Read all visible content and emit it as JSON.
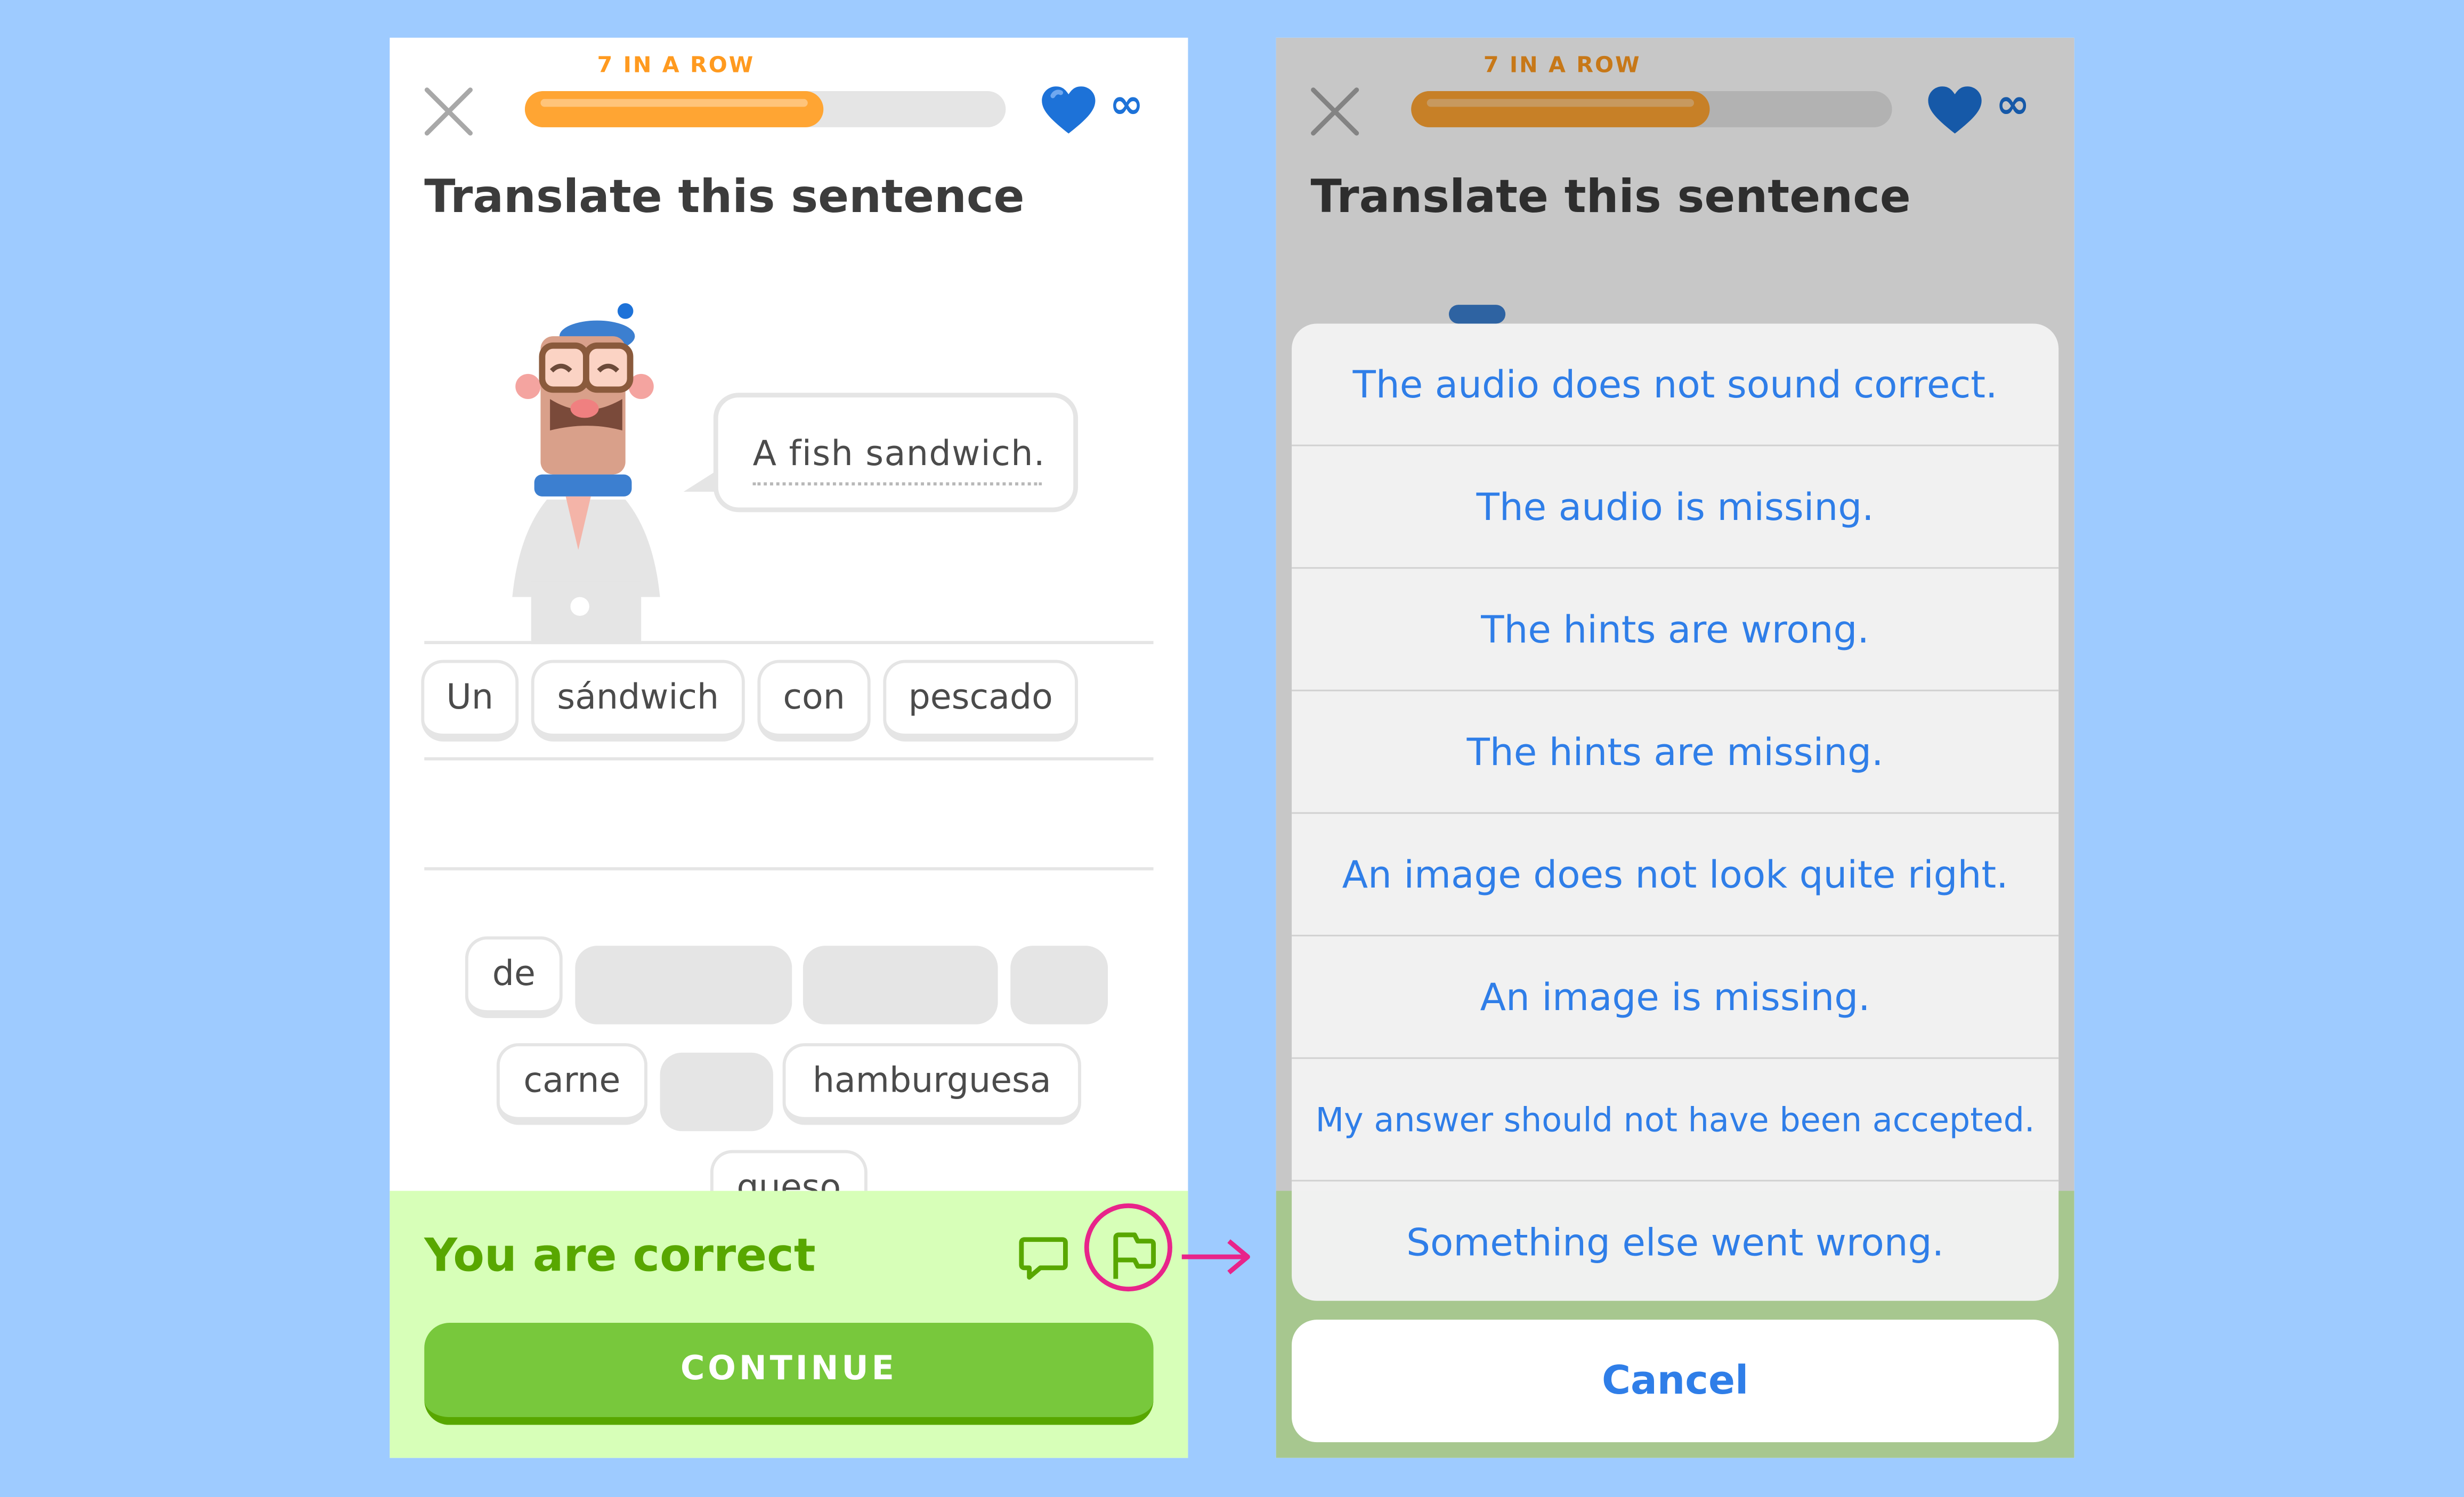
{
  "screen_left": {
    "streak_label": "7 IN A ROW",
    "progress": 0.62,
    "lives": "∞",
    "title": "Translate this sentence",
    "prompt": "A fish sandwich.",
    "answer_tiles": [
      "Un",
      "sándwich",
      "con",
      "pescado"
    ],
    "bank_tiles": [
      "de",
      "carne",
      "hamburguesa",
      "queso"
    ],
    "feedback": "You are correct",
    "continue_label": "CONTINUE"
  },
  "screen_right": {
    "streak_label": "7 IN A ROW",
    "lives": "∞",
    "title": "Translate this sentence",
    "report_options": [
      "The audio does not sound correct.",
      "The audio is missing.",
      "The hints are wrong.",
      "The hints are missing.",
      "An image does not look quite right.",
      "An image is missing.",
      "My answer should not have been accepted.",
      "Something else went wrong."
    ],
    "cancel_label": "Cancel"
  },
  "colors": {
    "background": "#9ecbff",
    "progress": "#ffa533",
    "heart": "#1d72d8",
    "correct_green": "#58a700",
    "continue_green": "#78c83c",
    "option_blue": "#2f7ee8",
    "highlight": "#e8248a"
  },
  "icons": [
    "close-icon",
    "heart-icon",
    "infinity-icon",
    "comment-icon",
    "flag-icon",
    "arrow-right-icon"
  ]
}
